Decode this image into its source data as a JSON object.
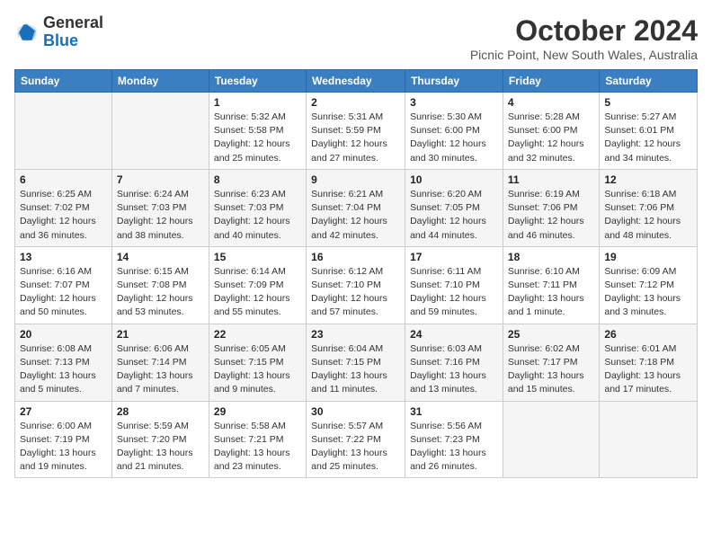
{
  "header": {
    "logo_general": "General",
    "logo_blue": "Blue",
    "month_title": "October 2024",
    "location": "Picnic Point, New South Wales, Australia"
  },
  "columns": [
    "Sunday",
    "Monday",
    "Tuesday",
    "Wednesday",
    "Thursday",
    "Friday",
    "Saturday"
  ],
  "weeks": [
    [
      {
        "day": "",
        "info": ""
      },
      {
        "day": "",
        "info": ""
      },
      {
        "day": "1",
        "info": "Sunrise: 5:32 AM\nSunset: 5:58 PM\nDaylight: 12 hours\nand 25 minutes."
      },
      {
        "day": "2",
        "info": "Sunrise: 5:31 AM\nSunset: 5:59 PM\nDaylight: 12 hours\nand 27 minutes."
      },
      {
        "day": "3",
        "info": "Sunrise: 5:30 AM\nSunset: 6:00 PM\nDaylight: 12 hours\nand 30 minutes."
      },
      {
        "day": "4",
        "info": "Sunrise: 5:28 AM\nSunset: 6:00 PM\nDaylight: 12 hours\nand 32 minutes."
      },
      {
        "day": "5",
        "info": "Sunrise: 5:27 AM\nSunset: 6:01 PM\nDaylight: 12 hours\nand 34 minutes."
      }
    ],
    [
      {
        "day": "6",
        "info": "Sunrise: 6:25 AM\nSunset: 7:02 PM\nDaylight: 12 hours\nand 36 minutes."
      },
      {
        "day": "7",
        "info": "Sunrise: 6:24 AM\nSunset: 7:03 PM\nDaylight: 12 hours\nand 38 minutes."
      },
      {
        "day": "8",
        "info": "Sunrise: 6:23 AM\nSunset: 7:03 PM\nDaylight: 12 hours\nand 40 minutes."
      },
      {
        "day": "9",
        "info": "Sunrise: 6:21 AM\nSunset: 7:04 PM\nDaylight: 12 hours\nand 42 minutes."
      },
      {
        "day": "10",
        "info": "Sunrise: 6:20 AM\nSunset: 7:05 PM\nDaylight: 12 hours\nand 44 minutes."
      },
      {
        "day": "11",
        "info": "Sunrise: 6:19 AM\nSunset: 7:06 PM\nDaylight: 12 hours\nand 46 minutes."
      },
      {
        "day": "12",
        "info": "Sunrise: 6:18 AM\nSunset: 7:06 PM\nDaylight: 12 hours\nand 48 minutes."
      }
    ],
    [
      {
        "day": "13",
        "info": "Sunrise: 6:16 AM\nSunset: 7:07 PM\nDaylight: 12 hours\nand 50 minutes."
      },
      {
        "day": "14",
        "info": "Sunrise: 6:15 AM\nSunset: 7:08 PM\nDaylight: 12 hours\nand 53 minutes."
      },
      {
        "day": "15",
        "info": "Sunrise: 6:14 AM\nSunset: 7:09 PM\nDaylight: 12 hours\nand 55 minutes."
      },
      {
        "day": "16",
        "info": "Sunrise: 6:12 AM\nSunset: 7:10 PM\nDaylight: 12 hours\nand 57 minutes."
      },
      {
        "day": "17",
        "info": "Sunrise: 6:11 AM\nSunset: 7:10 PM\nDaylight: 12 hours\nand 59 minutes."
      },
      {
        "day": "18",
        "info": "Sunrise: 6:10 AM\nSunset: 7:11 PM\nDaylight: 13 hours\nand 1 minute."
      },
      {
        "day": "19",
        "info": "Sunrise: 6:09 AM\nSunset: 7:12 PM\nDaylight: 13 hours\nand 3 minutes."
      }
    ],
    [
      {
        "day": "20",
        "info": "Sunrise: 6:08 AM\nSunset: 7:13 PM\nDaylight: 13 hours\nand 5 minutes."
      },
      {
        "day": "21",
        "info": "Sunrise: 6:06 AM\nSunset: 7:14 PM\nDaylight: 13 hours\nand 7 minutes."
      },
      {
        "day": "22",
        "info": "Sunrise: 6:05 AM\nSunset: 7:15 PM\nDaylight: 13 hours\nand 9 minutes."
      },
      {
        "day": "23",
        "info": "Sunrise: 6:04 AM\nSunset: 7:15 PM\nDaylight: 13 hours\nand 11 minutes."
      },
      {
        "day": "24",
        "info": "Sunrise: 6:03 AM\nSunset: 7:16 PM\nDaylight: 13 hours\nand 13 minutes."
      },
      {
        "day": "25",
        "info": "Sunrise: 6:02 AM\nSunset: 7:17 PM\nDaylight: 13 hours\nand 15 minutes."
      },
      {
        "day": "26",
        "info": "Sunrise: 6:01 AM\nSunset: 7:18 PM\nDaylight: 13 hours\nand 17 minutes."
      }
    ],
    [
      {
        "day": "27",
        "info": "Sunrise: 6:00 AM\nSunset: 7:19 PM\nDaylight: 13 hours\nand 19 minutes."
      },
      {
        "day": "28",
        "info": "Sunrise: 5:59 AM\nSunset: 7:20 PM\nDaylight: 13 hours\nand 21 minutes."
      },
      {
        "day": "29",
        "info": "Sunrise: 5:58 AM\nSunset: 7:21 PM\nDaylight: 13 hours\nand 23 minutes."
      },
      {
        "day": "30",
        "info": "Sunrise: 5:57 AM\nSunset: 7:22 PM\nDaylight: 13 hours\nand 25 minutes."
      },
      {
        "day": "31",
        "info": "Sunrise: 5:56 AM\nSunset: 7:23 PM\nDaylight: 13 hours\nand 26 minutes."
      },
      {
        "day": "",
        "info": ""
      },
      {
        "day": "",
        "info": ""
      }
    ]
  ]
}
